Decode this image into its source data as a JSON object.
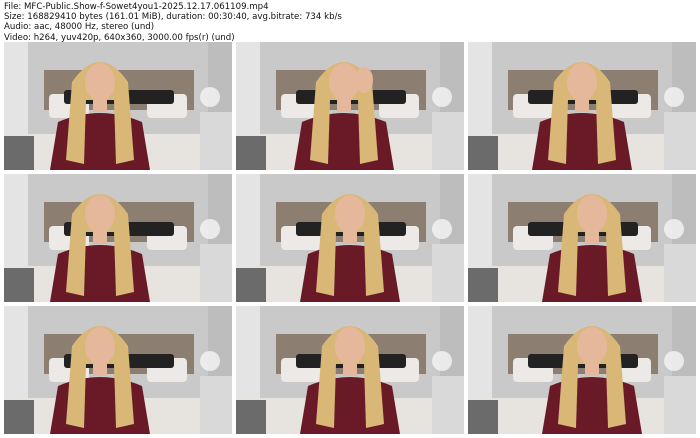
{
  "header": {
    "file": "File: MFC-Public.Show-f-Sowet4you1-2025.12.17.061109.mp4",
    "size": "Size: 168829410 bytes (161.01 MiB), duration: 00:30:40, avg.bitrate: 734 kb/s",
    "audio": "Audio: aac, 48000 Hz, stereo (und)",
    "video": "Video: h264, yuv420p, 640x360, 3000.00 fps(r) (und)"
  },
  "thumbnails": [
    {
      "id": 1,
      "pose": "left"
    },
    {
      "id": 2,
      "pose": "hand"
    },
    {
      "id": 3,
      "pose": "center"
    },
    {
      "id": 4,
      "pose": "left"
    },
    {
      "id": 5,
      "pose": "center"
    },
    {
      "id": 6,
      "pose": "right"
    },
    {
      "id": 7,
      "pose": "left"
    },
    {
      "id": 8,
      "pose": "center"
    },
    {
      "id": 9,
      "pose": "right"
    }
  ],
  "colors": {
    "wall": "#c9c9c9",
    "headboard": "#8c7f72",
    "pillow": "#ece9e6",
    "dark_pillow": "#222222",
    "bedding": "#e7e3df",
    "shirt": "#6a1a27",
    "hair": "#d9b777",
    "skin": "#e6b89b"
  }
}
